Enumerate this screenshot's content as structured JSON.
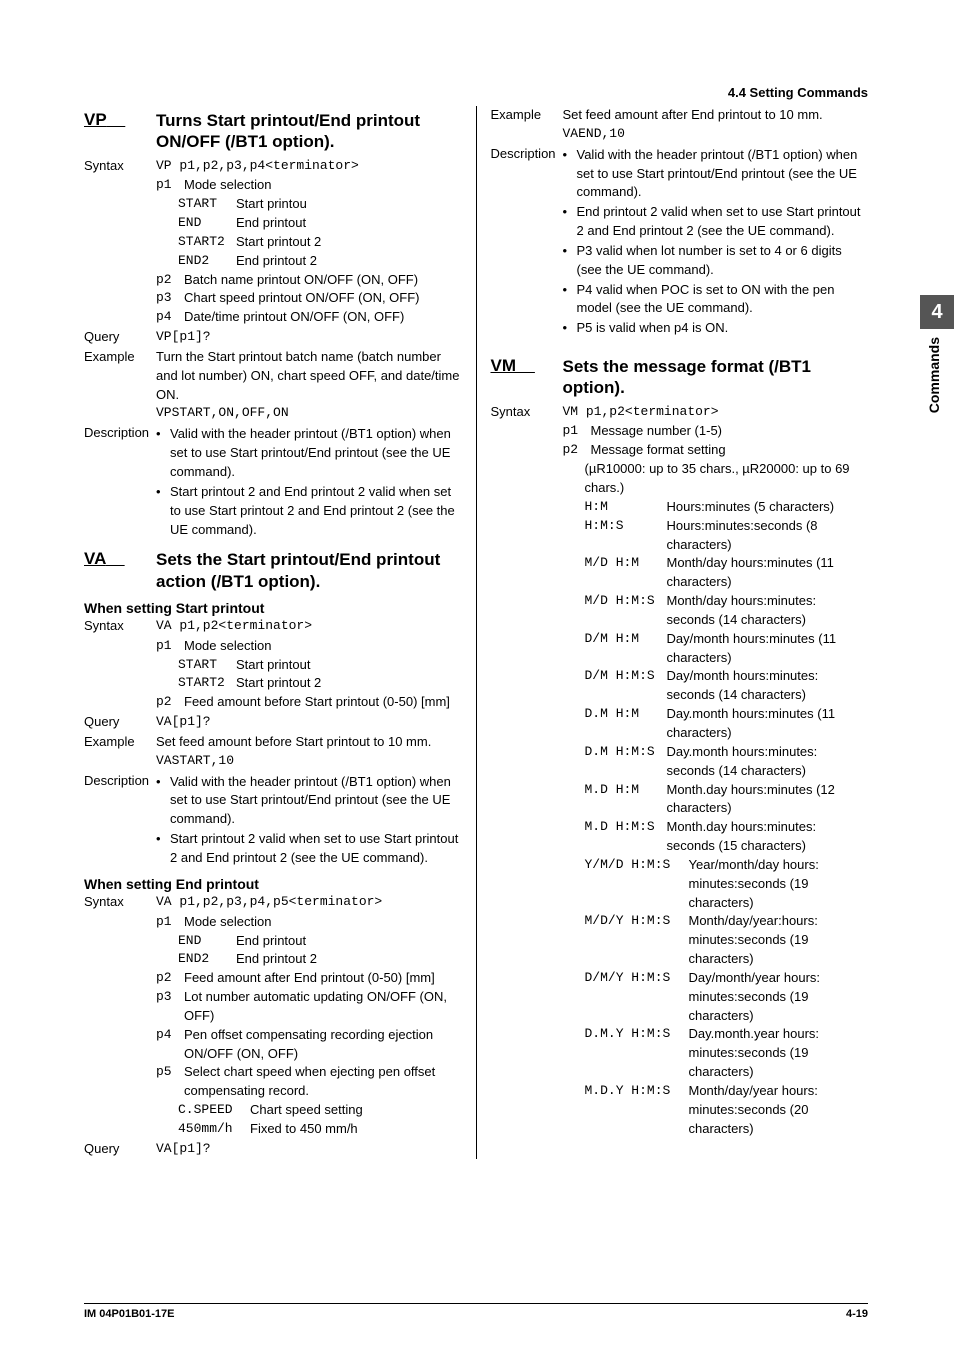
{
  "runningHead": "4.4  Setting Commands",
  "thumb": {
    "num": "4",
    "label": "Commands"
  },
  "footer": {
    "docid": "IM 04P01B01-17E",
    "pageno": "4-19"
  },
  "vp": {
    "code": "VP",
    "title": "Turns Start printout/End printout ON/OFF (/BT1 option).",
    "syntaxLabel": "Syntax",
    "syntax": "VP p1,p2,p3,p4<terminator>",
    "p1label": "Mode selection",
    "p1_opts": [
      {
        "k": "START",
        "v": "Start printou"
      },
      {
        "k": "END",
        "v": "End printout"
      },
      {
        "k": "START2",
        "v": "Start printout 2"
      },
      {
        "k": "END2",
        "v": "End printout 2"
      }
    ],
    "p2": "Batch name printout ON/OFF (ON, OFF)",
    "p3": "Chart speed printout ON/OFF (ON, OFF)",
    "p4": "Date/time printout ON/OFF (ON, OFF)",
    "queryLabel": "Query",
    "query": "VP[p1]?",
    "exampleLabel": "Example",
    "exampleText": "Turn the Start printout batch name (batch number and lot number) ON, chart speed OFF, and date/time ON.",
    "exampleCode": "VPSTART,ON,OFF,ON",
    "descLabel": "Description",
    "descBullets": [
      "Valid with the header printout (/BT1 option) when set to use Start printout/End printout (see the UE command).",
      "Start printout 2 and End printout 2 valid when set to use Start printout 2 and End printout 2 (see the UE command)."
    ]
  },
  "va": {
    "code": "VA",
    "title": "Sets the Start printout/End printout action (/BT1 option).",
    "sub1": "When setting Start printout",
    "syntaxLabel": "Syntax",
    "syntax1": "VA p1,p2<terminator>",
    "p1label": "Mode selection",
    "p1_opts1": [
      {
        "k": "START",
        "v": "Start printout"
      },
      {
        "k": "START2",
        "v": "Start printout 2"
      }
    ],
    "p2_1": "Feed amount before Start printout (0-50) [mm]",
    "queryLabel": "Query",
    "query1": "VA[p1]?",
    "exampleLabel": "Example",
    "example1Text": "Set feed amount before Start printout to 10 mm.",
    "example1Code": "VASTART,10",
    "descLabel": "Description",
    "descBullets1": [
      "Valid with the header printout (/BT1 option) when set to use Start printout/End printout (see the UE command).",
      "Start printout 2 valid when set to use Start printout 2 and End printout 2 (see the UE command)."
    ],
    "sub2": "When setting End printout",
    "syntax2": "VA p1,p2,p3,p4,p5<terminator>",
    "p1_opts2": [
      {
        "k": "END",
        "v": "End printout"
      },
      {
        "k": "END2",
        "v": "End printout 2"
      }
    ],
    "p2_2": "Feed amount after End printout (0-50) [mm]",
    "p3_2": "Lot number automatic updating ON/OFF (ON, OFF)",
    "p4_2": "Pen offset compensating recording ejection ON/OFF (ON, OFF)",
    "p5_2": "Select chart speed when ejecting pen offset compensating record.",
    "p5_opts": [
      {
        "k": "C.SPEED",
        "v": "Chart speed setting"
      },
      {
        "k": "450mm/h",
        "v": "Fixed to 450 mm/h"
      }
    ],
    "query2": "VA[p1]?",
    "example2Text": "Set feed amount after End printout to 10 mm.",
    "example2Code": "VAEND,10",
    "descBullets2": [
      "Valid with the header printout (/BT1 option) when set to use Start printout/End printout (see the UE command).",
      "End printout 2 valid when set to use Start printout 2 and End printout 2 (see the UE command).",
      "P3 valid when lot number is set to 4 or 6 digits (see the UE command).",
      "P4 valid when POC is set to ON with the pen model (see the UE command).",
      "P5 is valid when p4 is ON."
    ]
  },
  "vm": {
    "code": "VM",
    "title": "Sets the message format (/BT1 option).",
    "syntaxLabel": "Syntax",
    "syntax": "VM p1,p2<terminator>",
    "p1": "Message number (1-5)",
    "p2": "Message format setting",
    "p2note": "(µR10000: up to 35 chars., µR20000: up to 69 chars.)",
    "fmts": [
      {
        "k": "H:M",
        "v": "Hours:minutes (5 characters)"
      },
      {
        "k": "H:M:S",
        "v": "Hours:minutes:seconds (8 characters)"
      },
      {
        "k": "M/D H:M",
        "v": "Month/day hours:minutes (11 characters)"
      },
      {
        "k": "M/D H:M:S",
        "v": "Month/day hours:minutes: seconds (14 characters)"
      },
      {
        "k": "D/M H:M",
        "v": "Day/month hours:minutes (11 characters)"
      },
      {
        "k": "D/M H:M:S",
        "v": "Day/month hours:minutes: seconds (14 characters)"
      },
      {
        "k": "D.M H:M",
        "v": "Day.month hours:minutes (11 characters)"
      },
      {
        "k": "D.M H:M:S",
        "v": "Day.month hours:minutes: seconds (14 characters)"
      },
      {
        "k": "M.D H:M",
        "v": "Month.day hours:minutes (12 characters)"
      },
      {
        "k": "M.D H:M:S",
        "v": "Month.day hours:minutes: seconds (15 characters)"
      }
    ],
    "fmts_wide": [
      {
        "k": "Y/M/D H:M:S",
        "v": "Year/month/day hours: minutes:seconds (19 characters)"
      },
      {
        "k": "M/D/Y H:M:S",
        "v": "Month/day/year:hours: minutes:seconds (19 characters)"
      },
      {
        "k": "D/M/Y H:M:S",
        "v": "Day/month/year hours: minutes:seconds (19 characters)"
      },
      {
        "k": "D.M.Y H:M:S",
        "v": "Day.month.year hours: minutes:seconds (19 characters)"
      },
      {
        "k": "M.D.Y H:M:S",
        "v": "Month/day/year hours: minutes:seconds (20 characters)"
      }
    ]
  }
}
